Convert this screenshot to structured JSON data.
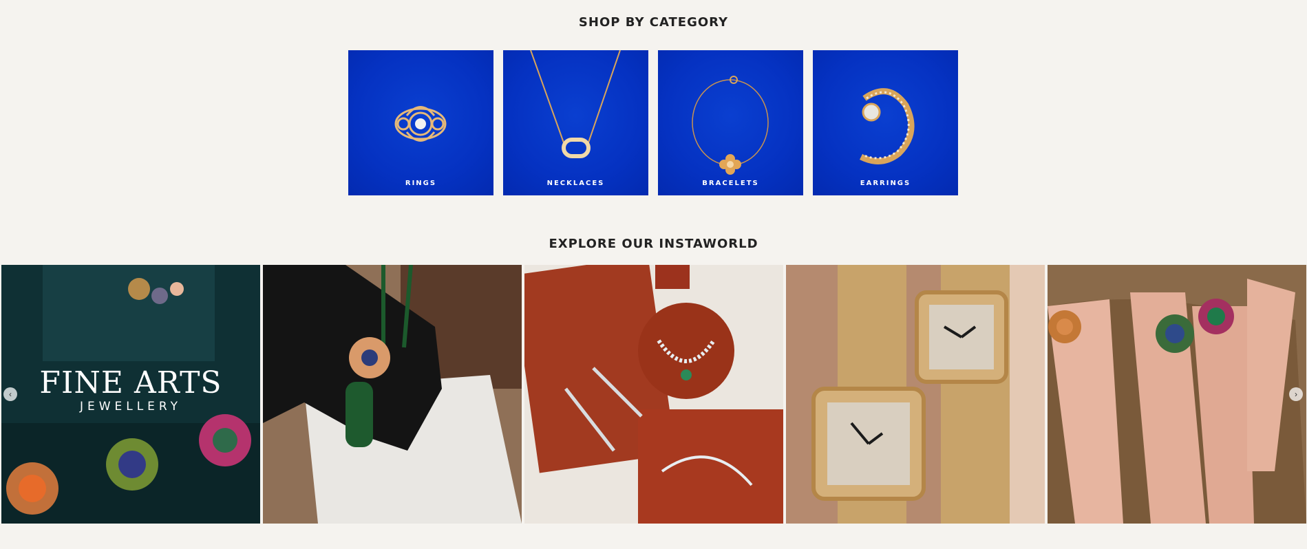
{
  "shop_by_category": {
    "title": "SHOP BY CATEGORY",
    "items": [
      {
        "label": "RINGS",
        "icon": "ring-icon"
      },
      {
        "label": "NECKLACES",
        "icon": "necklace-icon"
      },
      {
        "label": "BRACELETS",
        "icon": "bracelet-icon"
      },
      {
        "label": "EARRINGS",
        "icon": "earring-icon"
      }
    ],
    "card_color": "#0532c2"
  },
  "instaworld": {
    "title": "EXPLORE OUR INSTAWORLD",
    "tiles": [
      {
        "overlay_main": "FINE ARTS",
        "overlay_sub": "JEWELLERY"
      },
      {},
      {},
      {},
      {}
    ],
    "prev_icon": "chevron-left-icon",
    "next_icon": "chevron-right-icon"
  },
  "colors": {
    "background": "#f5f3ef",
    "category_blue": "#0532c2",
    "gold": "#d9a55a"
  }
}
